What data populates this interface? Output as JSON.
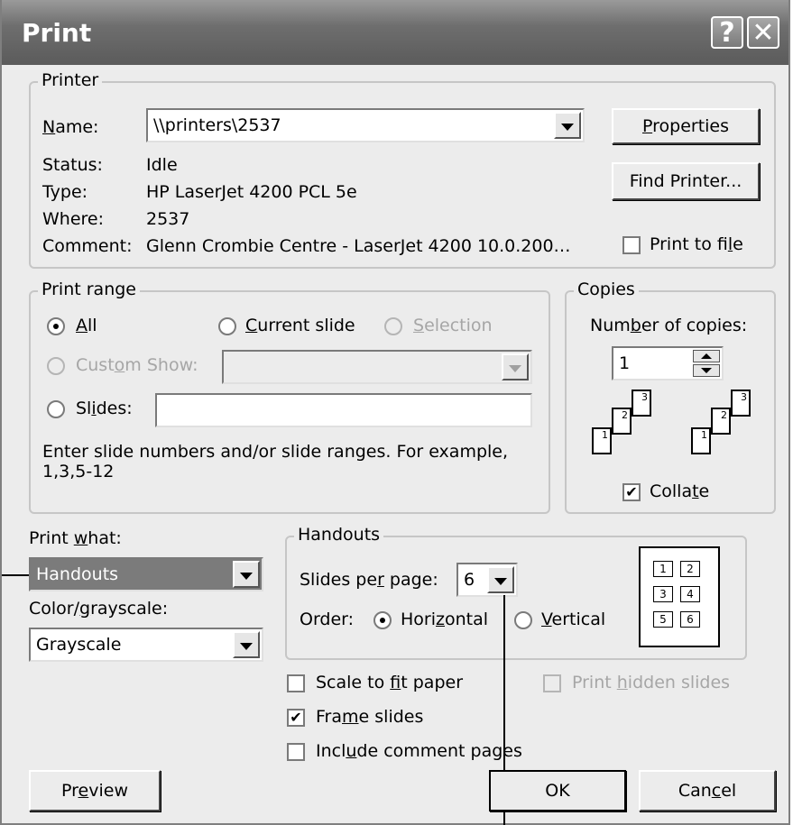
{
  "window": {
    "title": "Print",
    "help_symbol": "?",
    "close_symbol": "✕"
  },
  "printer": {
    "group_label": "Printer",
    "name_label": "Name:",
    "name_value": "\\\\printers\\2537",
    "status_label": "Status:",
    "status_value": "Idle",
    "type_label": "Type:",
    "type_value": "HP LaserJet 4200 PCL 5e",
    "where_label": "Where:",
    "where_value": "2537",
    "comment_label": "Comment:",
    "comment_value": "Glenn Crombie Centre - LaserJet 4200 10.0.200…",
    "properties_button": "Properties",
    "find_printer_button": "Find Printer...",
    "print_to_file_label": "Print to file",
    "print_to_file_checked": false
  },
  "print_range": {
    "group_label": "Print range",
    "all_label": "All",
    "current_slide_label": "Current slide",
    "selection_label": "Selection",
    "custom_show_label": "Custom Show:",
    "slides_label": "Slides:",
    "slides_value": "",
    "hint": "Enter slide numbers and/or slide ranges. For example,",
    "hint_example": "1,3,5-12",
    "selected": "All"
  },
  "copies": {
    "group_label": "Copies",
    "number_label": "Number of copies:",
    "number_value": "1",
    "collate_label": "Collate",
    "collate_checked": true,
    "page_numbers": [
      "1",
      "2",
      "3"
    ]
  },
  "print_what": {
    "label": "Print what:",
    "value": "Handouts",
    "color_label": "Color/grayscale:",
    "color_value": "Grayscale"
  },
  "handouts": {
    "group_label": "Handouts",
    "slides_per_page_label": "Slides per page:",
    "slides_per_page_value": "6",
    "order_label": "Order:",
    "horizontal_label": "Horizontal",
    "vertical_label": "Vertical",
    "selected_order": "Horizontal",
    "preview_cells": [
      "1",
      "2",
      "3",
      "4",
      "5",
      "6"
    ]
  },
  "options": {
    "scale_to_fit_label": "Scale to fit paper",
    "scale_to_fit_checked": false,
    "frame_slides_label": "Frame slides",
    "frame_slides_checked": true,
    "include_comments_label": "Include comment pages",
    "include_comments_checked": false,
    "print_hidden_label": "Print hidden slides",
    "print_hidden_checked": false
  },
  "buttons": {
    "preview": "Preview",
    "ok": "OK",
    "cancel": "Cancel"
  },
  "check_mark": "✔"
}
